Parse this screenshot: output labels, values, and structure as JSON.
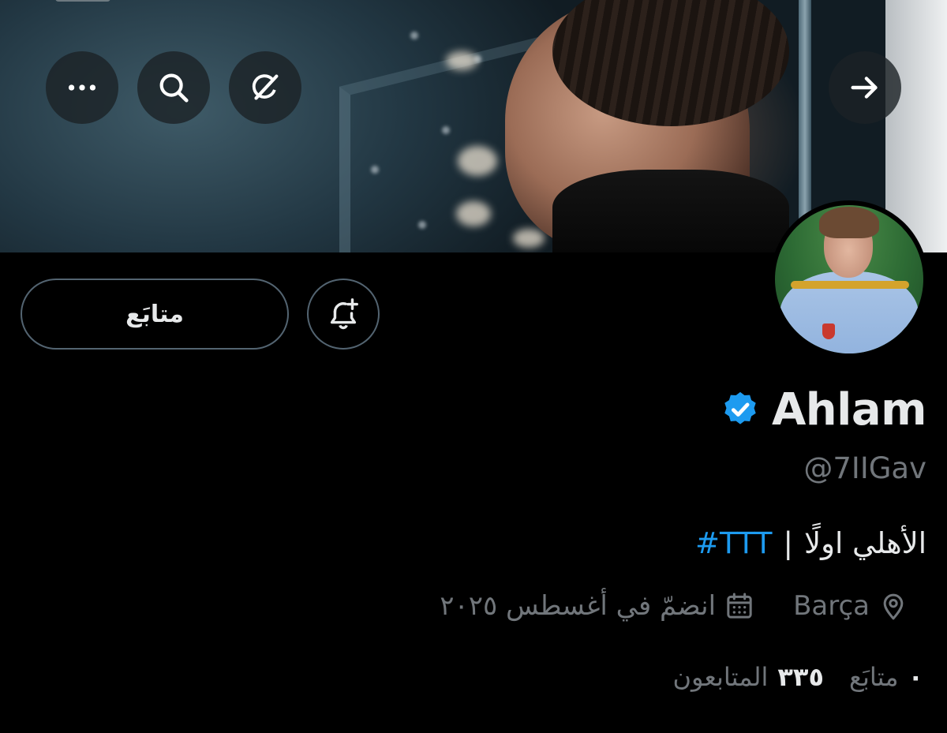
{
  "header": {
    "back_icon": "arrow-right-icon",
    "actions": [
      {
        "icon": "grok-icon"
      },
      {
        "icon": "search-icon"
      },
      {
        "icon": "more-icon"
      }
    ]
  },
  "profile": {
    "display_name": "Ahlam",
    "verified": true,
    "verified_color": "#1d9bf0",
    "handle": "@7IIGav",
    "bio_text": "الأهلي اولًا",
    "bio_separator": "|",
    "bio_hashtag": "#TTT",
    "location": "Barça",
    "joined": "انضمّ في أغسطس ٢٠٢٥",
    "follow_button_label": "متابَع",
    "stats": {
      "following_count": "٠",
      "following_label": "متابَع",
      "followers_count": "٣٣٥",
      "followers_label": "المتابعون"
    }
  },
  "colors": {
    "background": "#000000",
    "text_primary": "#e7e9ea",
    "text_secondary": "#71767b",
    "accent": "#1d9bf0",
    "border": "#536471"
  }
}
